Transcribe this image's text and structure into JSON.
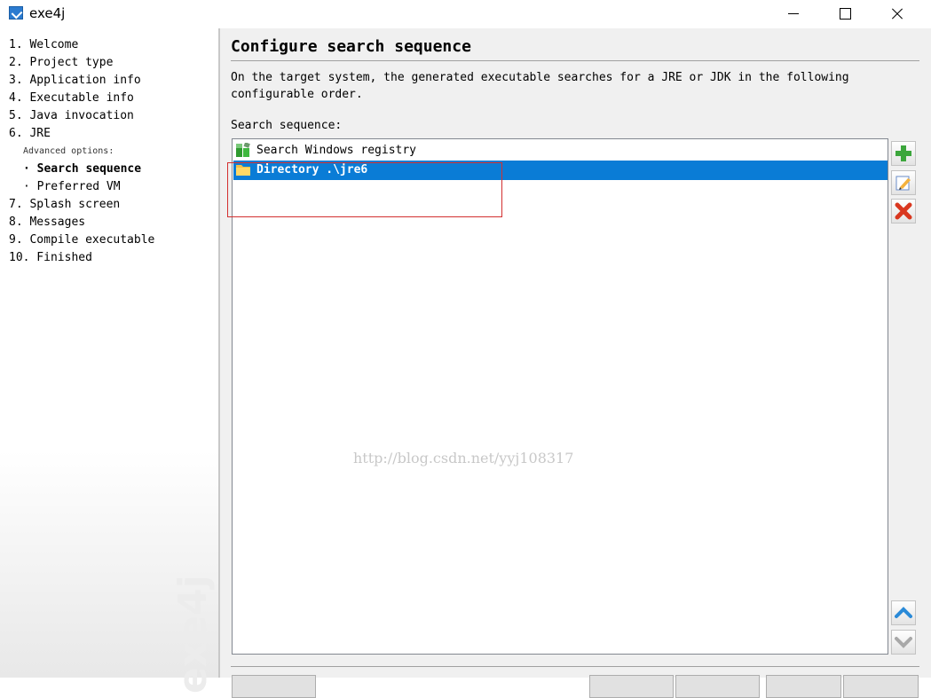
{
  "window": {
    "title": "exe4j",
    "icons": {
      "app": "exe4j-app-icon",
      "minimize": "minimize-icon",
      "maximize": "maximize-icon",
      "close": "close-icon"
    }
  },
  "sidebar": {
    "steps": [
      {
        "label": "1. Welcome"
      },
      {
        "label": "2. Project type"
      },
      {
        "label": "3. Application info"
      },
      {
        "label": "4. Executable info"
      },
      {
        "label": "5. Java invocation"
      },
      {
        "label": "6. JRE"
      },
      {
        "label": "Advanced options:"
      },
      {
        "label": "· Search sequence"
      },
      {
        "label": "· Preferred VM"
      },
      {
        "label": "7. Splash screen"
      },
      {
        "label": "8. Messages"
      },
      {
        "label": "9. Compile executable"
      },
      {
        "label": "10. Finished"
      }
    ],
    "current_step": "· Search sequence",
    "watermark": "exe4j"
  },
  "main": {
    "title": "Configure search sequence",
    "description": "On the target system, the generated executable searches for a JRE or JDK in the following configurable order.",
    "list_label": "Search sequence:",
    "items": [
      {
        "label": "Search Windows registry",
        "icon": "windows-registry-icon"
      },
      {
        "label": "Directory .\\jre6",
        "icon": "folder-icon",
        "selected": true
      }
    ],
    "watermark_text": "http://blog.csdn.net/yyj108317",
    "buttons": {
      "add": "add-icon",
      "edit": "edit-icon",
      "remove": "remove-icon",
      "move_up": "chevron-up-icon",
      "move_down": "chevron-down-icon"
    },
    "colors": {
      "selection": "#0a7cd6",
      "highlight_box": "#d32f2f",
      "add": "#3ca63c",
      "remove": "#d9371f",
      "arrows": "#2a8ad8"
    }
  }
}
